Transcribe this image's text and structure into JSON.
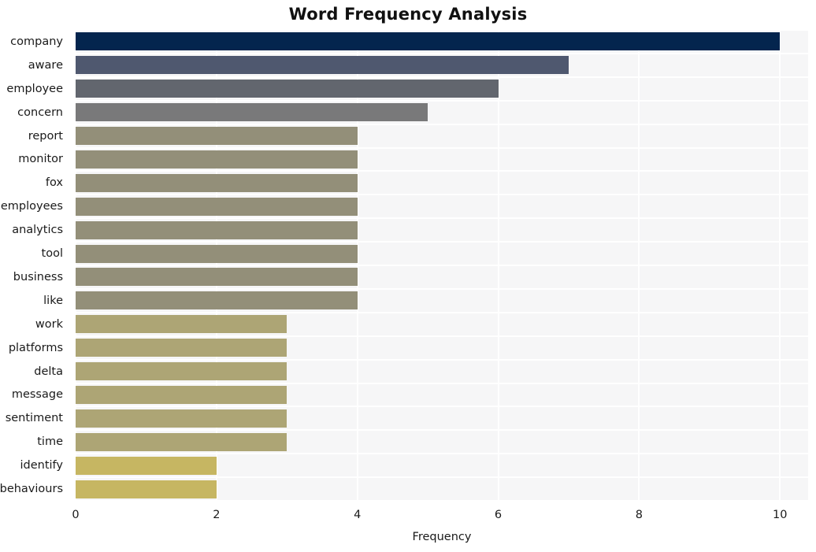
{
  "chart_data": {
    "type": "bar",
    "orientation": "horizontal",
    "title": "Word Frequency Analysis",
    "xlabel": "Frequency",
    "ylabel": "",
    "xlim": [
      0,
      10.4
    ],
    "ylim": [
      0,
      20
    ],
    "grid": true,
    "legend": null,
    "xticks": [
      0,
      2,
      4,
      6,
      8,
      10
    ],
    "xtick_labels": [
      "0",
      "2",
      "4",
      "6",
      "8",
      "10"
    ],
    "categories": [
      "company",
      "aware",
      "employee",
      "concern",
      "report",
      "monitor",
      "fox",
      "employees",
      "analytics",
      "tool",
      "business",
      "like",
      "work",
      "platforms",
      "delta",
      "message",
      "sentiment",
      "time",
      "identify",
      "behaviours"
    ],
    "values": [
      10,
      7,
      6,
      5,
      4,
      4,
      4,
      4,
      4,
      4,
      4,
      4,
      3,
      3,
      3,
      3,
      3,
      3,
      2,
      2
    ],
    "bar_colors": [
      "#04254e",
      "#4f586f",
      "#62666e",
      "#79797a",
      "#938f79",
      "#938f79",
      "#938f79",
      "#938f79",
      "#938f79",
      "#938f79",
      "#938f79",
      "#938f79",
      "#ada575",
      "#ada575",
      "#ada575",
      "#ada575",
      "#ada575",
      "#ada575",
      "#c6b662",
      "#c6b662"
    ],
    "plot_background": "#f6f6f7",
    "gridline_color": "#ffffff",
    "figure_background": "#ffffff",
    "text_color": "#1a1a1a"
  }
}
